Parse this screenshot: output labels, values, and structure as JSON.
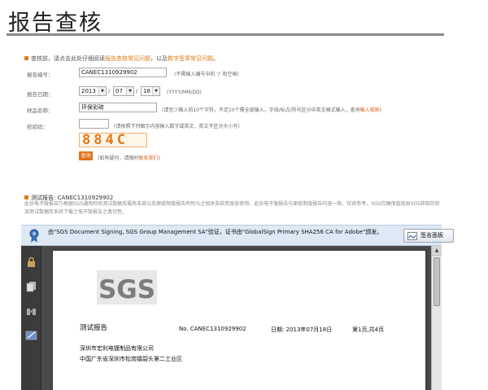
{
  "page": {
    "title": "报告查核"
  },
  "intro": {
    "text_before": "查核前，请点击此处仔细阅读",
    "link1": "报告查核常见问题",
    "text_mid": "，以及",
    "link2": "数字签章常见问题",
    "text_after": "。"
  },
  "form": {
    "report_no": {
      "label": "报告编号：",
      "value": "CANEC1310929902",
      "hint": "(不需输入编号中的 '/' 和空格)"
    },
    "report_date": {
      "label": "报告日期：",
      "year": "2013",
      "month": "07",
      "day": "18",
      "hint": "(YYYY/MM/DD)"
    },
    "sample_name": {
      "label": "样品名称：",
      "value": "环保彩砖",
      "hint_before": "(请至少输入前10个字符，不足10个需全部输入，字母/标点/符号区分中英文格式输入，查询",
      "hint_link": "输入规则",
      "hint_after": ")"
    },
    "captcha": {
      "label": "校验码：",
      "value": "",
      "hint": "(请按照下列图示内容输入数字或英文，英文不区分大小写)",
      "image_text": "884C"
    },
    "query_button": "查询",
    "help_before": "(如有疑问，请随时",
    "help_link": "联系我们",
    "help_after": ")"
  },
  "report": {
    "heading": "测试报告: CANEC1310929902",
    "description": "此份电子版报告乃根据SGS通用检验测试数据库服务条款以及原纸制版报告所附与之相关条款而发放使用。此份电子版报告与原纸制版报告内容一致。仅供参考。SGS仅确保直接由SGS获取的检测测试数据库系统下载之电子版报告之真切性。"
  },
  "signature_bar": {
    "text": "由\"SGS Document Signing, SGS Group Management SA\"验证，证书由\"GlobalSign Primary SHA256 CA for Adobe\"颁发。",
    "button": "签名面板"
  },
  "document": {
    "logo_text": "SGS",
    "title": "测试报告",
    "number": "No. CANEC1310929902",
    "date": "日期: 2013年07月18日",
    "page": "第1页,共4页",
    "company": "深圳市宏利电镀制品有限公司",
    "address": "中国广东省深圳市松岗镇碧头第二工业区"
  },
  "colors": {
    "accent": "#e07a1a",
    "sigbar": "#dfe9f5",
    "reader_bg": "#4a4a4a"
  }
}
